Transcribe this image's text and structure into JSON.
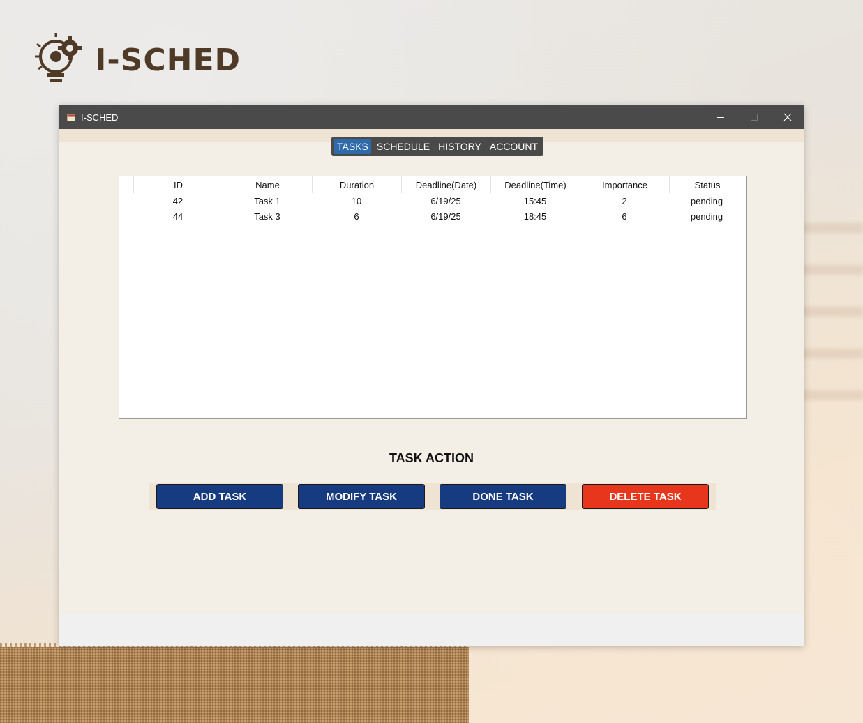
{
  "brand": {
    "title": "I-SCHED",
    "icon": "lightbulb-gear-icon"
  },
  "window": {
    "title": "I-SCHED",
    "icon": "calendar-icon",
    "controls": [
      "minimize-icon",
      "maximize-icon",
      "close-icon"
    ]
  },
  "tabs": [
    {
      "label": "TASKS",
      "active": true
    },
    {
      "label": "SCHEDULE",
      "active": false
    },
    {
      "label": "HISTORY",
      "active": false
    },
    {
      "label": "ACCOUNT",
      "active": false
    }
  ],
  "table": {
    "columns": [
      "ID",
      "Name",
      "Duration",
      "Deadline(Date)",
      "Deadline(Time)",
      "Importance",
      "Status"
    ],
    "rows": [
      [
        "42",
        "Task 1",
        "10",
        "6/19/25",
        "15:45",
        "2",
        "pending"
      ],
      [
        "44",
        "Task 3",
        "6",
        "6/19/25",
        "18:45",
        "6",
        "pending"
      ]
    ]
  },
  "actions": {
    "title": "TASK ACTION",
    "add": "ADD TASK",
    "modify": "MODIFY TASK",
    "done": "DONE TASK",
    "delete": "DELETE TASK"
  },
  "colors": {
    "titlebar": "#4a4a4a",
    "tab_active": "#2f6aaa",
    "button_primary": "#163b80",
    "button_danger": "#e8361c",
    "brand_text": "#4f3a28"
  }
}
